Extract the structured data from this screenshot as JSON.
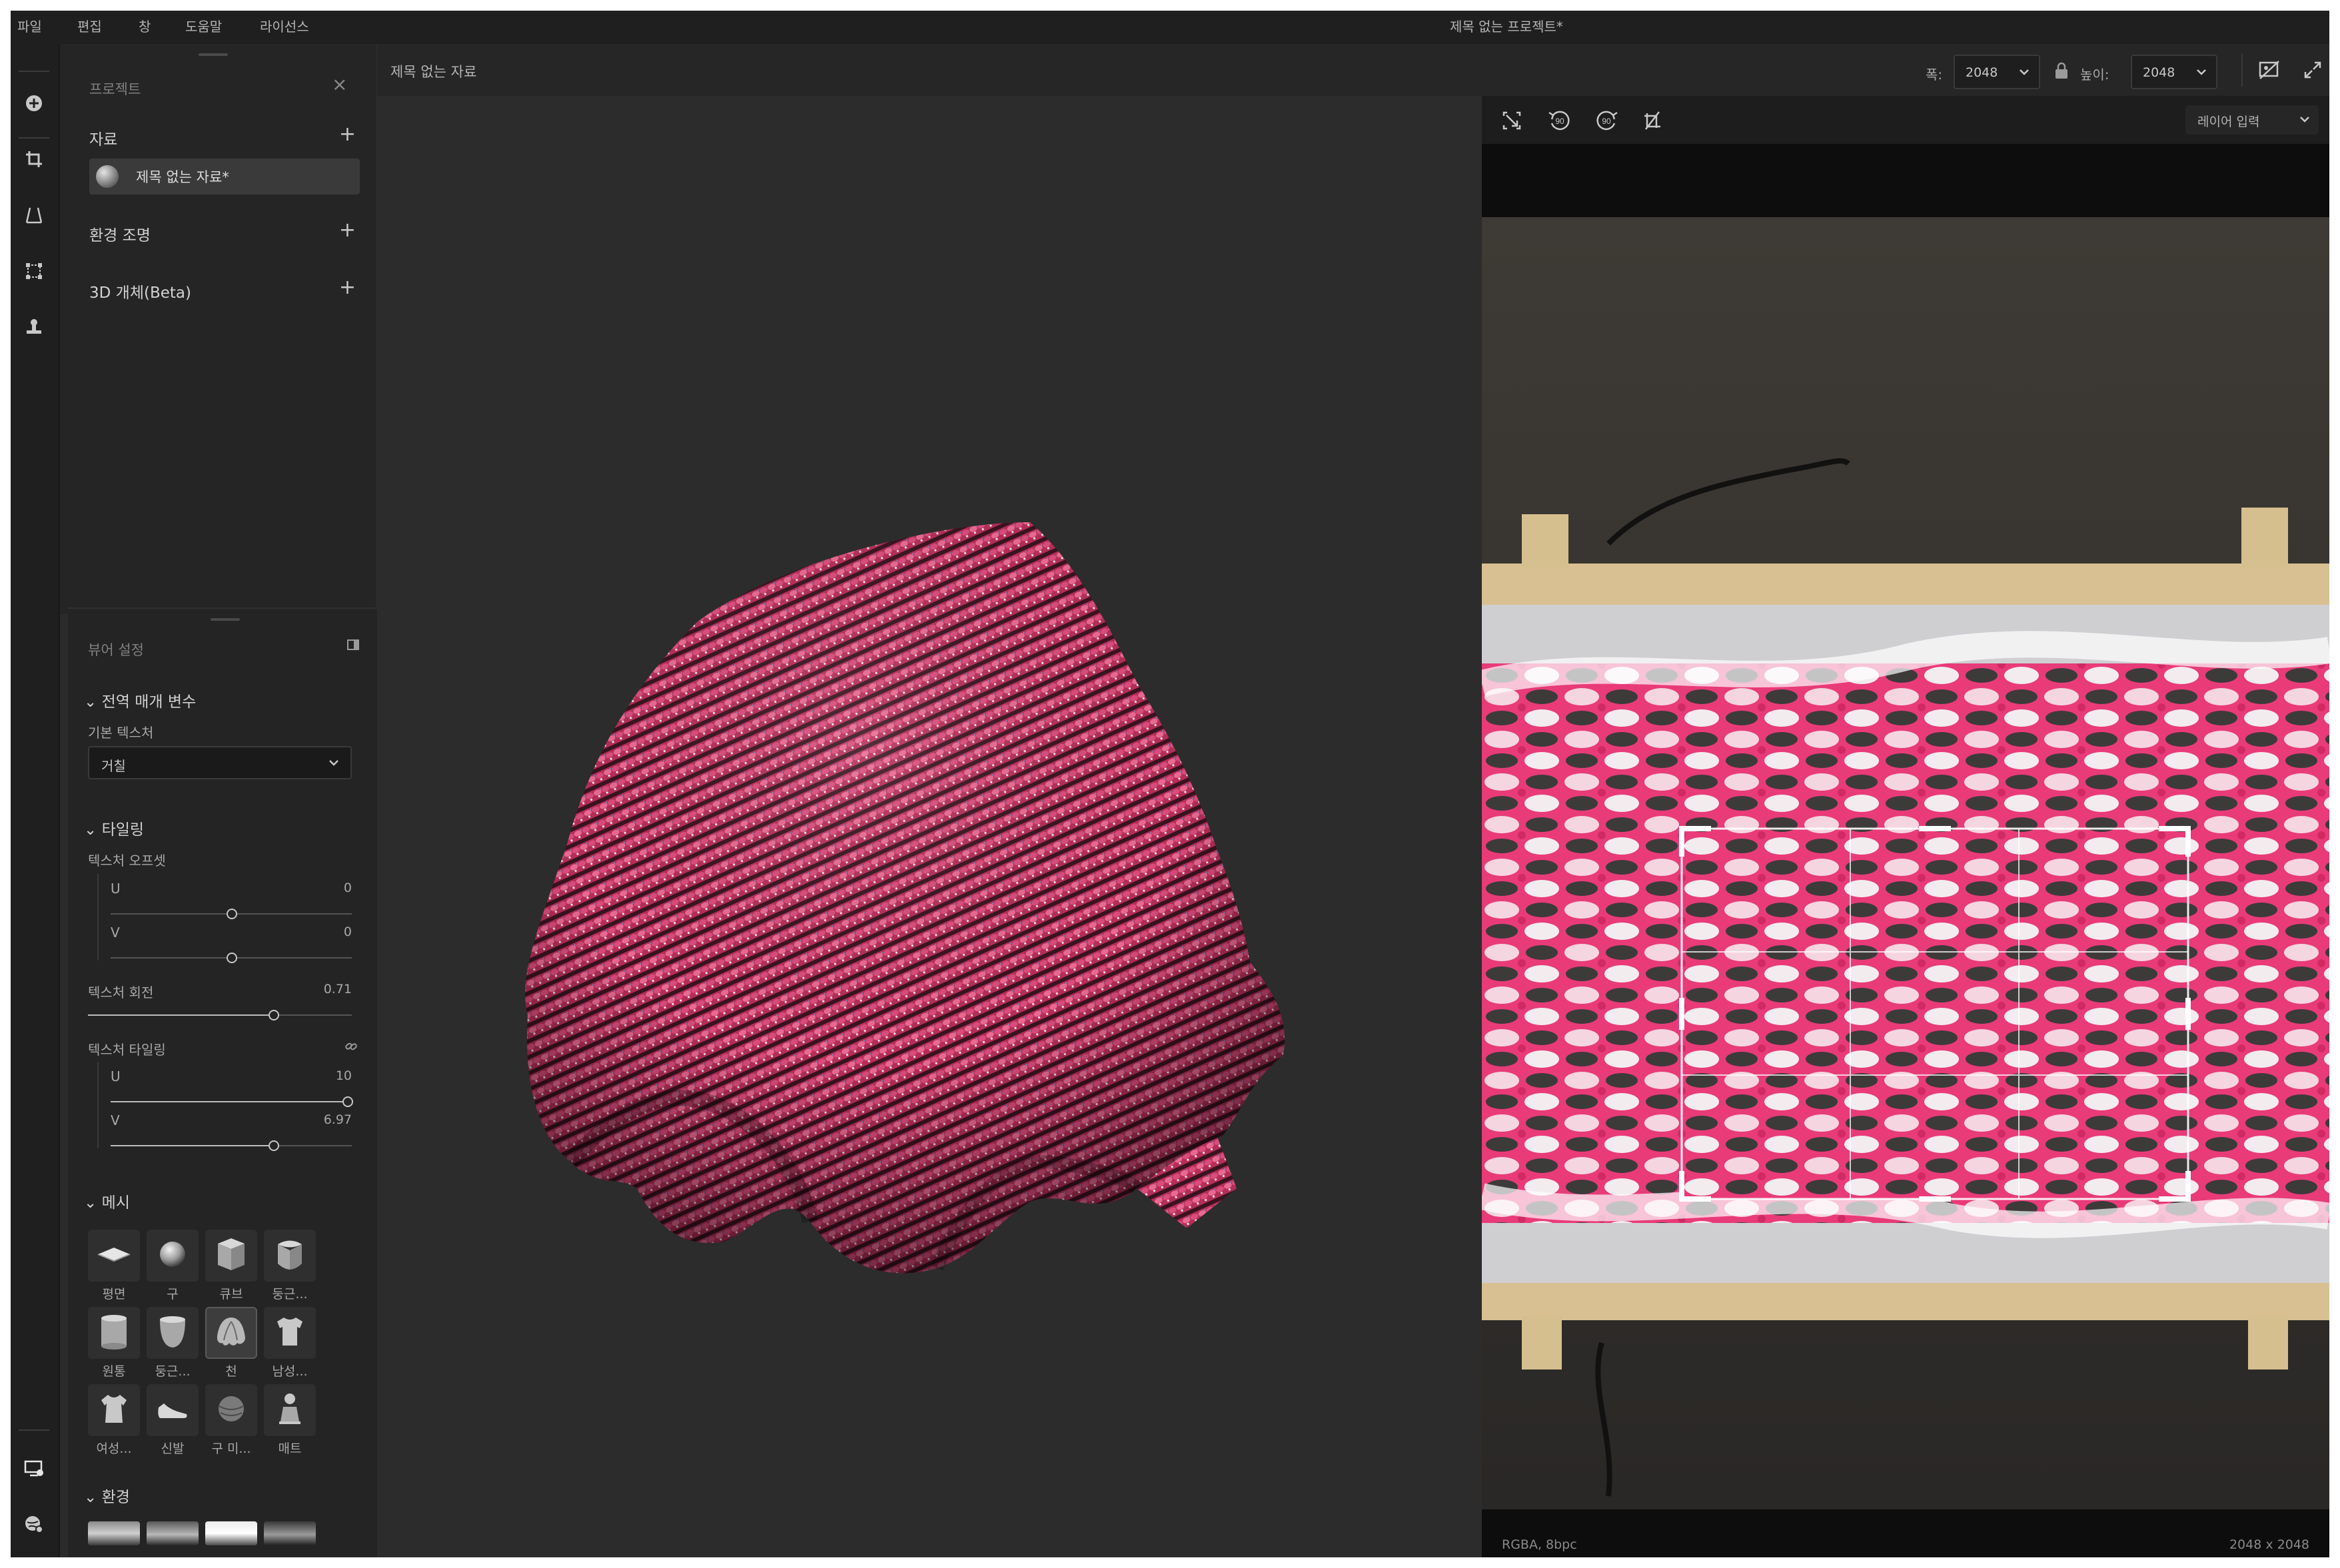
{
  "menu": {
    "items": [
      "파일",
      "편집",
      "창",
      "도움말",
      "라이선스"
    ]
  },
  "window_title": "제목 없는 프로젝트*",
  "project_panel": {
    "title": "프로젝트",
    "sections": {
      "materials": "자료",
      "env_light": "환경 조명",
      "objects": "3D 개체(Beta)"
    },
    "material_item": "제목 없는 자료*"
  },
  "viewer_panel": {
    "title": "뷰어 설정",
    "global_params": "전역 매개 변수",
    "base_texture": {
      "label": "기본 텍스처",
      "value": "거칠"
    },
    "tiling": {
      "heading": "타일링",
      "offset_label": "텍스처 오프셋",
      "u": {
        "label": "U",
        "value": "0",
        "fraction": 0.5
      },
      "v": {
        "label": "V",
        "value": "0",
        "fraction": 0.5
      },
      "rotation": {
        "label": "텍스처 회전",
        "value": "0.71",
        "fraction": 0.71
      },
      "tiling_label": "텍스처 타일링",
      "tu": {
        "label": "U",
        "value": "10",
        "fraction": 1.0
      },
      "tv": {
        "label": "V",
        "value": "6.97",
        "fraction": 0.68
      }
    },
    "mesh": {
      "heading": "메시",
      "items": [
        {
          "label": "평면",
          "icon": "plane-icon"
        },
        {
          "label": "구",
          "icon": "sphere-icon"
        },
        {
          "label": "큐브",
          "icon": "cube-icon"
        },
        {
          "label": "둥근...",
          "icon": "rounded-cube-icon"
        },
        {
          "label": "원통",
          "icon": "cylinder-icon"
        },
        {
          "label": "둥근...",
          "icon": "rounded-cylinder-icon"
        },
        {
          "label": "천",
          "icon": "cloth-icon"
        },
        {
          "label": "남성...",
          "icon": "male-shirt-icon"
        },
        {
          "label": "여성...",
          "icon": "female-shirt-icon"
        },
        {
          "label": "신발",
          "icon": "shoe-icon"
        },
        {
          "label": "구 미...",
          "icon": "sphere-mini-icon"
        },
        {
          "label": "매트",
          "icon": "mannequin-icon"
        }
      ],
      "selected_index": 6
    },
    "environment": {
      "heading": "환경"
    }
  },
  "doc": {
    "title": "제목 없는 자료",
    "width_label": "폭:",
    "width_value": "2048",
    "height_label": "높이:",
    "height_value": "2048"
  },
  "viewport2d": {
    "layer_dropdown": "레이어 입력",
    "status_left": "RGBA, 8bpc",
    "status_right": "2048 x 2048"
  },
  "colors": {
    "accent_pink": "#e0406e",
    "panel_bg": "#252525",
    "app_bg": "#2b2b2b"
  }
}
